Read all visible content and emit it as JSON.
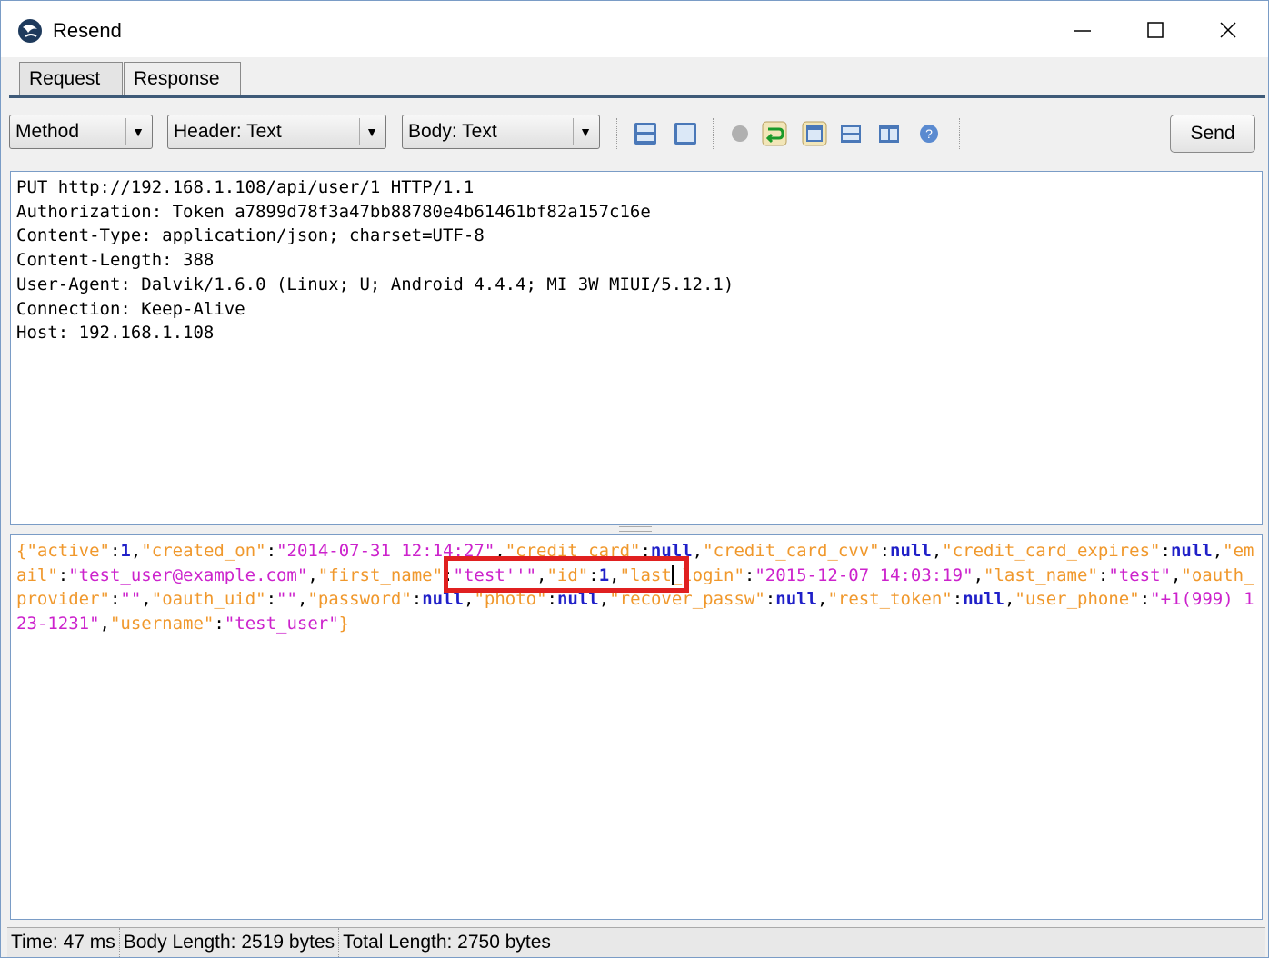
{
  "window": {
    "title": "Resend",
    "minimize_glyph": "—",
    "maximize_glyph": "☐",
    "close_glyph": "✕"
  },
  "tabs": [
    {
      "label": "Request",
      "active": true
    },
    {
      "label": "Response",
      "active": false
    }
  ],
  "toolbar": {
    "method_label": "Method",
    "header_label": "Header: Text",
    "body_label": "Body: Text",
    "send_label": "Send",
    "icons": [
      "split-view-icon",
      "single-view-icon",
      "stop-icon",
      "wrap-icon",
      "header-body-icon",
      "horizontal-split-icon",
      "vertical-split-icon",
      "help-icon"
    ]
  },
  "request_header": [
    "PUT http://192.168.1.108/api/user/1 HTTP/1.1",
    "Authorization: Token a7899d78f3a47bb88780e4b61461bf82a157c16e",
    "Content-Type: application/json; charset=UTF-8",
    "Content-Length: 388",
    "User-Agent: Dalvik/1.6.0 (Linux; U; Android 4.4.4; MI 3W MIUI/5.12.1)",
    "Connection: Keep-Alive",
    "Host: 192.168.1.108"
  ],
  "request_body": {
    "open": "{",
    "close": "}",
    "fields": [
      {
        "key": "\"active\"",
        "value": "1",
        "type": "number"
      },
      {
        "key": "\"created_on\"",
        "value": "\"2014-07-31 12:14:27\"",
        "type": "string"
      },
      {
        "key": "\"credit_card\"",
        "value": "null",
        "type": "null"
      },
      {
        "key": "\"credit_card_cvv\"",
        "value": "null",
        "type": "null"
      },
      {
        "key": "\"credit_card_expires\"",
        "value": "null",
        "type": "null"
      },
      {
        "key": "\"email\"",
        "value": "\"test_user@example.com\"",
        "type": "string"
      },
      {
        "key": "\"first_name\"",
        "value": "\"test''\"",
        "type": "string"
      },
      {
        "key": "\"id\"",
        "value": "1",
        "type": "number"
      },
      {
        "key": "\"last_login\"",
        "value": "\"2015-12-07 14:03:19\"",
        "type": "string"
      },
      {
        "key": "\"last_name\"",
        "value": "\"test\"",
        "type": "string"
      },
      {
        "key": "\"oauth_provider\"",
        "value": "\"\"",
        "type": "string"
      },
      {
        "key": "\"oauth_uid\"",
        "value": "\"\"",
        "type": "string"
      },
      {
        "key": "\"password\"",
        "value": "null",
        "type": "null"
      },
      {
        "key": "\"photo\"",
        "value": "null",
        "type": "null"
      },
      {
        "key": "\"recover_passw\"",
        "value": "null",
        "type": "null"
      },
      {
        "key": "\"rest_token\"",
        "value": "null",
        "type": "null"
      },
      {
        "key": "\"user_phone\"",
        "value": "\"+1(999) 123-1231\"",
        "type": "string"
      },
      {
        "key": "\"username\"",
        "value": "\"test_user\"",
        "type": "string"
      }
    ]
  },
  "status": {
    "time": "Time: 47 ms",
    "body_length": "Body Length: 2519 bytes",
    "total_length": "Total Length: 2750 bytes"
  },
  "colors": {
    "key": "#f0982c",
    "string": "#cc22cc",
    "literal": "#2020c8",
    "highlight": "#e02020"
  }
}
